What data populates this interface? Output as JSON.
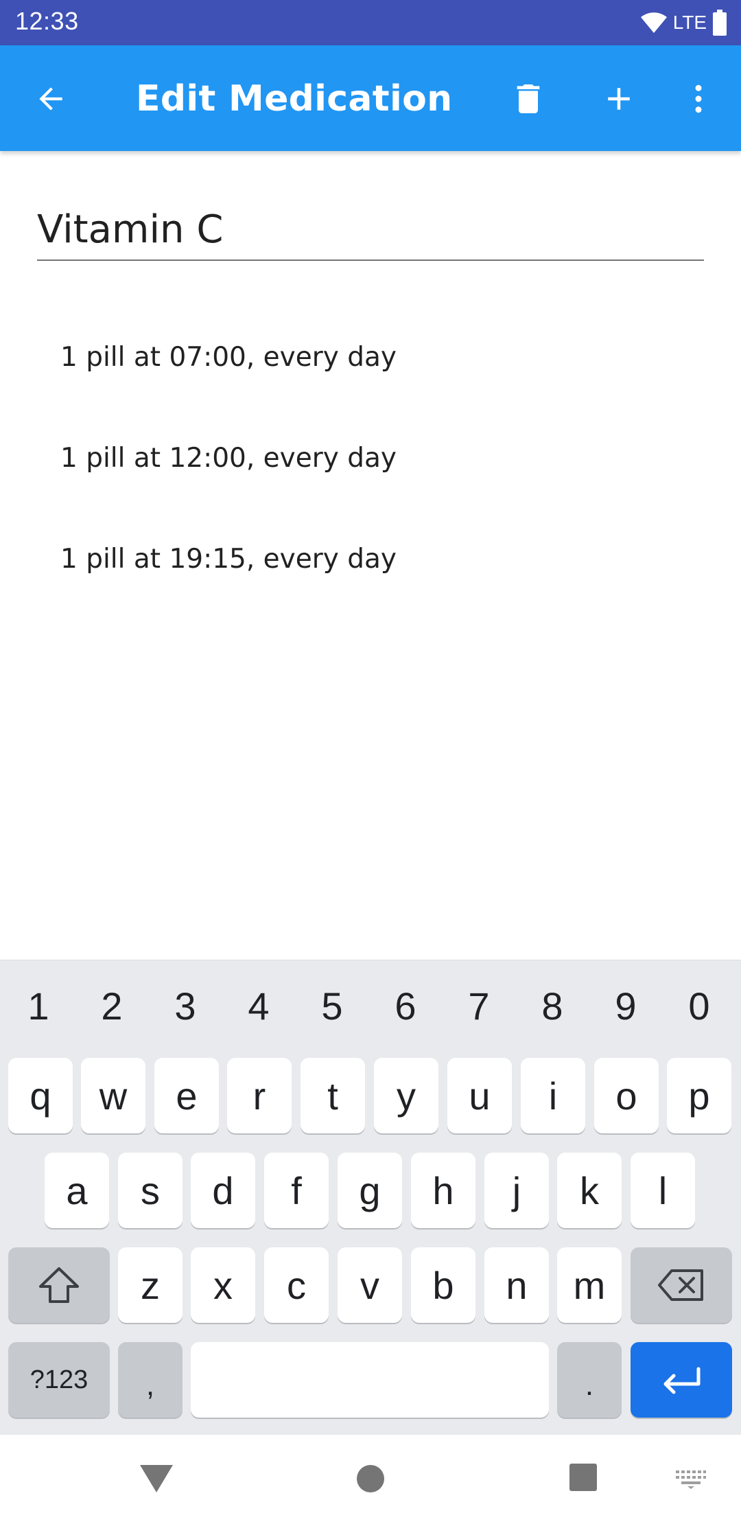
{
  "status_bar": {
    "time": "12:33",
    "network": "LTE"
  },
  "app_bar": {
    "title": "Edit Medication",
    "icons": [
      "back-arrow-icon",
      "trash-icon",
      "plus-icon",
      "more-vert-icon"
    ],
    "color": "#2196f3"
  },
  "medication": {
    "name": "Vitamin C"
  },
  "schedule": [
    {
      "text": "1 pill at 07:00, every day"
    },
    {
      "text": "1 pill at 12:00, every day"
    },
    {
      "text": "1 pill at 19:15, every day"
    }
  ],
  "keyboard": {
    "numbers": [
      "1",
      "2",
      "3",
      "4",
      "5",
      "6",
      "7",
      "8",
      "9",
      "0"
    ],
    "row1": [
      "q",
      "w",
      "e",
      "r",
      "t",
      "y",
      "u",
      "i",
      "o",
      "p"
    ],
    "row2": [
      "a",
      "s",
      "d",
      "f",
      "g",
      "h",
      "j",
      "k",
      "l"
    ],
    "row3": [
      "z",
      "x",
      "c",
      "v",
      "b",
      "n",
      "m"
    ],
    "symbols_label": "?123",
    "comma": ",",
    "period": ".",
    "enter_color": "#1a73e8"
  },
  "nav_bar": {
    "icons": [
      "back-triangle-icon",
      "home-circle-icon",
      "recents-square-icon",
      "keyboard-icon"
    ]
  }
}
